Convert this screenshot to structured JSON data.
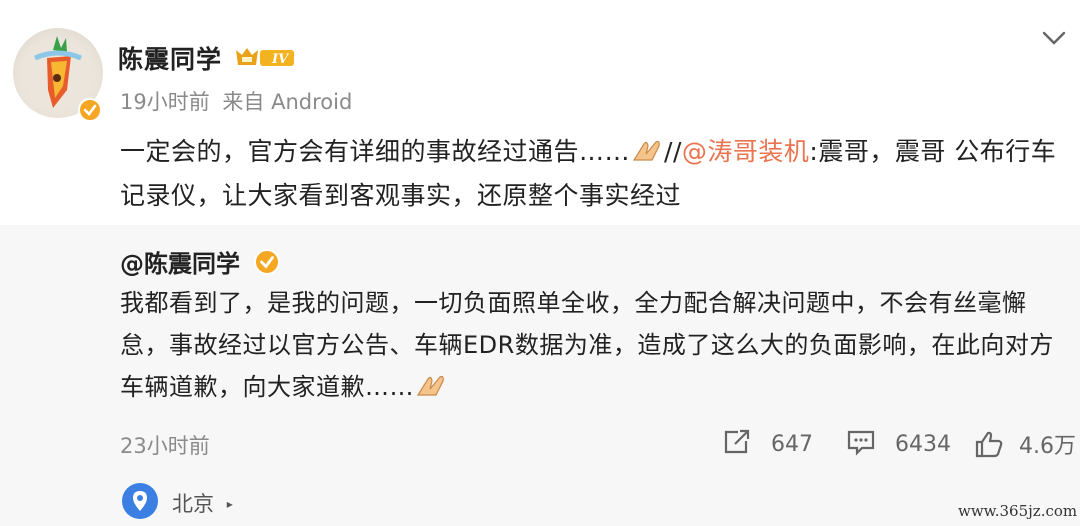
{
  "author": {
    "name": "陈震同学",
    "level_badge": "IV",
    "time": "19小时前",
    "source": "来自 Android"
  },
  "post": {
    "text_before": "一定会的，官方会有详细的事故经过通告……",
    "separator": "//",
    "mention": "@涛哥装机",
    "text_after": ":震哥，震哥 公布行车记录仪，让大家看到客观事实，还原整个事实经过"
  },
  "quoted": {
    "author": "@陈震同学",
    "text": "我都看到了，是我的问题，一切负面照单全收，全力配合解决问题中，不会有丝毫懈怠，事故经过以官方公告、车辆EDR数据为准，造成了这么大的负面影响，在此向对方车辆道歉，向大家道歉……",
    "time": "23小时前",
    "reposts": "647",
    "comments": "6434",
    "likes": "4.6万",
    "location": "北京"
  },
  "watermark": "www.365jz.com",
  "icons": {
    "menu": "chevron-down-icon",
    "verified": "verified-badge-icon",
    "repost": "repost-icon",
    "comment": "comment-icon",
    "like": "thumbs-up-icon",
    "location": "location-pin-icon",
    "emoji": "pray-hands-emoji"
  },
  "colors": {
    "mention": "#eb7350",
    "verified": "#f5a623",
    "location": "#3b7fe3",
    "quote_bg": "#f7f7f7"
  }
}
